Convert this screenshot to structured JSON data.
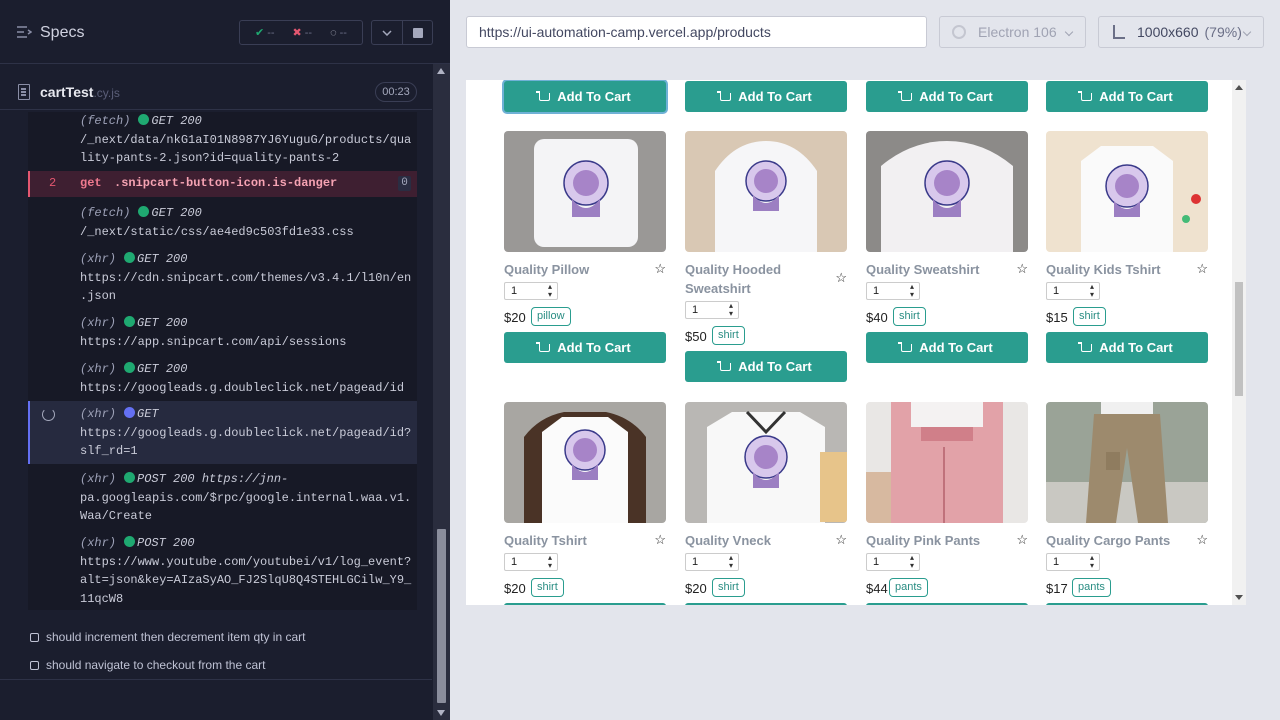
{
  "reporter": {
    "specs_label": "Specs",
    "stats": {
      "passed": "--",
      "failed": "--",
      "pending": "--"
    },
    "file": {
      "name": "cartTest",
      "ext": ".cy.js",
      "duration": "00:23"
    },
    "commands": [
      {
        "kind": "(fetch)",
        "method": "GET 200",
        "url": "/_next/data/nkG1aI01N8987YJ6YuguG/products/qua",
        "url2": "lity-pants-2.json?id=quality-pants-2"
      },
      {
        "num": "2",
        "name": "get",
        "selector": ".snipcart-button-icon.is-danger",
        "count": "0"
      },
      {
        "kind": "(fetch)",
        "method": "GET 200",
        "url": "/_next/static/css/ae4ed9c503fd1e33.css"
      },
      {
        "kind": "(xhr)",
        "method": "GET 200",
        "url": "https://cdn.snipcart.com/themes/v3.4.1/l10n/en",
        "url2": ".json"
      },
      {
        "kind": "(xhr)",
        "method": "GET 200",
        "url": "https://app.snipcart.com/api/sessions"
      },
      {
        "kind": "(xhr)",
        "method": "GET 200",
        "url": "https://googleads.g.doubleclick.net/pagead/id"
      },
      {
        "kind": "(xhr)",
        "method": "GET",
        "url": "https://googleads.g.doubleclick.net/pagead/id?",
        "url2": "slf_rd=1"
      },
      {
        "kind": "(xhr)",
        "method": "POST 200 https://jnn-",
        "url": "pa.googleapis.com/$rpc/google.internal.waa.v1.",
        "url2": "Waa/Create"
      },
      {
        "kind": "(xhr)",
        "method": "POST 200",
        "url": "https://www.youtube.com/youtubei/v1/log_event?",
        "url2": "alt=json&key=AIzaSyAO_FJ2SlqU8Q4STEHLGCilw_Y9_",
        "url3": "11qcW8"
      }
    ],
    "tests": [
      "should increment then decrement item qty in cart",
      "should navigate to checkout from the cart"
    ]
  },
  "aut_header": {
    "url": "https://ui-automation-camp.vercel.app/products",
    "browser": "Electron 106",
    "viewport": "1000x660",
    "zoom": "(79%)"
  },
  "add_to_cart_label": "Add To Cart",
  "products": [
    {
      "name": "Quality Pillow",
      "qty": "1",
      "price": "$20",
      "tag": "pillow"
    },
    {
      "name": "Quality Hooded Sweatshirt",
      "qty": "1",
      "price": "$50",
      "tag": "shirt"
    },
    {
      "name": "Quality Sweatshirt",
      "qty": "1",
      "price": "$40",
      "tag": "shirt"
    },
    {
      "name": "Quality Kids Tshirt",
      "qty": "1",
      "price": "$15",
      "tag": "shirt"
    },
    {
      "name": "Quality Tshirt",
      "qty": "1",
      "price": "$20",
      "tag": "shirt"
    },
    {
      "name": "Quality Vneck",
      "qty": "1",
      "price": "$20",
      "tag": "shirt"
    },
    {
      "name": "Quality Pink Pants",
      "qty": "1",
      "price": "$44",
      "tag": "pants"
    },
    {
      "name": "Quality Cargo Pants",
      "qty": "1",
      "price": "$17",
      "tag": "pants"
    }
  ],
  "colors": {
    "accent": "#2a9d8f",
    "pass": "#1fa971",
    "fail": "#e45770",
    "pending": "#6470f3"
  }
}
